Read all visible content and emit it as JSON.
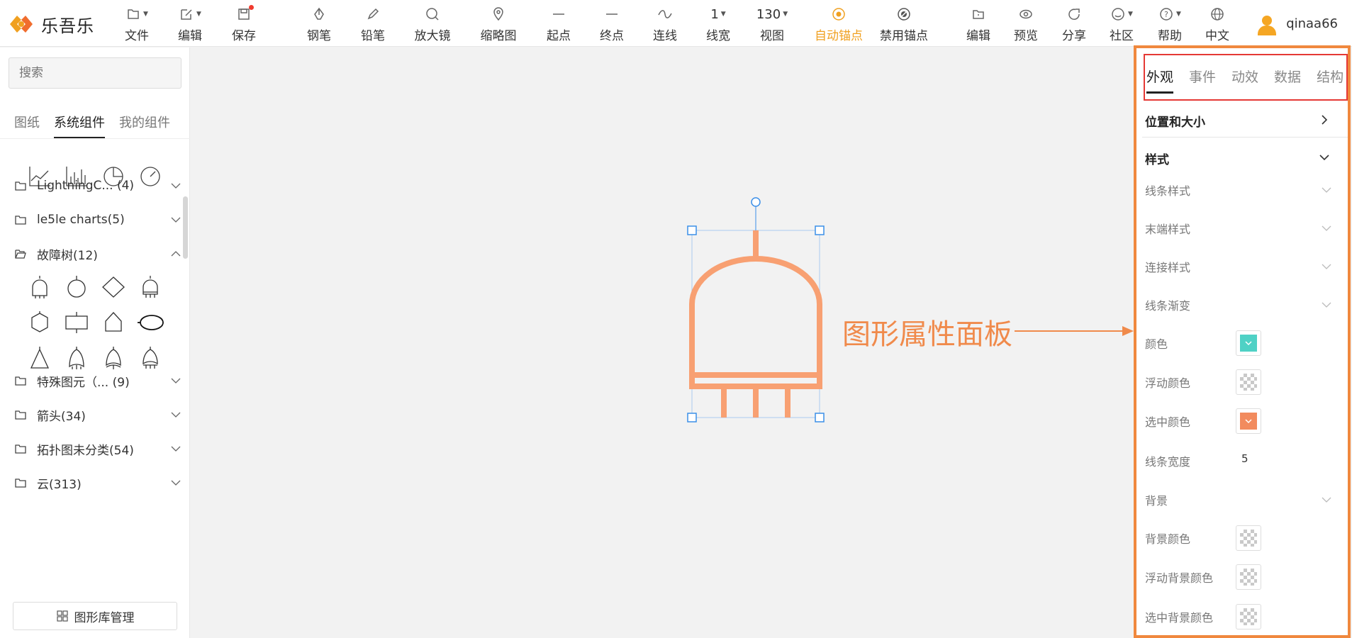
{
  "app": {
    "name": "乐吾乐"
  },
  "toolbar": {
    "items": [
      {
        "label": "文件",
        "icon": "file-icon"
      },
      {
        "label": "编辑",
        "icon": "edit-icon"
      },
      {
        "label": "保存",
        "icon": "save-icon"
      },
      {
        "label": "钢笔",
        "icon": "pen-icon"
      },
      {
        "label": "铅笔",
        "icon": "pencil-icon"
      },
      {
        "label": "放大镜",
        "icon": "magnifier-icon"
      },
      {
        "label": "缩略图",
        "icon": "map-pin-icon"
      },
      {
        "label": "起点",
        "icon": "line-start-icon"
      },
      {
        "label": "终点",
        "icon": "line-end-icon"
      },
      {
        "label": "连线",
        "icon": "curve-icon"
      },
      {
        "label": "线宽",
        "value": "1"
      },
      {
        "label": "视图",
        "value": "130"
      },
      {
        "label": "自动锚点",
        "icon": "target-icon",
        "active": true
      },
      {
        "label": "禁用锚点",
        "icon": "disable-anchor-icon"
      },
      {
        "label": "编辑",
        "icon": "folder-edit-icon"
      },
      {
        "label": "预览",
        "icon": "eye-icon"
      },
      {
        "label": "分享",
        "icon": "share-icon"
      },
      {
        "label": "社区",
        "icon": "smile-icon"
      },
      {
        "label": "帮助",
        "icon": "help-icon"
      },
      {
        "label": "中文",
        "icon": "globe-icon"
      }
    ],
    "user": {
      "name": "qinaa66"
    }
  },
  "left": {
    "search_placeholder": "搜索",
    "tabs": [
      "图纸",
      "系统组件",
      "我的组件"
    ],
    "groups": [
      {
        "name": "LightningC...",
        "count": "(4)"
      },
      {
        "name": "le5le charts(5)",
        "count": ""
      },
      {
        "name": "故障树(12)",
        "count": ""
      },
      {
        "name": "特殊图元（...",
        "count": "(9)"
      },
      {
        "name": "箭头(34)",
        "count": ""
      },
      {
        "name": "拓扑图未分类(54)",
        "count": ""
      },
      {
        "name": "云(313)",
        "count": ""
      }
    ],
    "library_button": "图形库管理"
  },
  "canvas": {
    "annotation": "图形属性面板"
  },
  "right": {
    "tabs": [
      "外观",
      "事件",
      "动效",
      "数据",
      "结构"
    ],
    "section_position": "位置和大小",
    "section_style": "样式",
    "rows": {
      "line_style": "线条样式",
      "end_style": "末端样式",
      "join_style": "连接样式",
      "line_gradient": "线条渐变",
      "color": "颜色",
      "hover_color": "浮动颜色",
      "selected_color": "选中颜色",
      "line_width": "线条宽度",
      "line_width_value": "5",
      "background": "背景",
      "bg_color": "背景颜色",
      "hover_bg_color": "浮动背景颜色",
      "selected_bg_color": "选中背景颜色"
    },
    "colors": {
      "color": "#4fd1c5",
      "selected": "#f28b5e",
      "accent": "#f0883e"
    }
  }
}
